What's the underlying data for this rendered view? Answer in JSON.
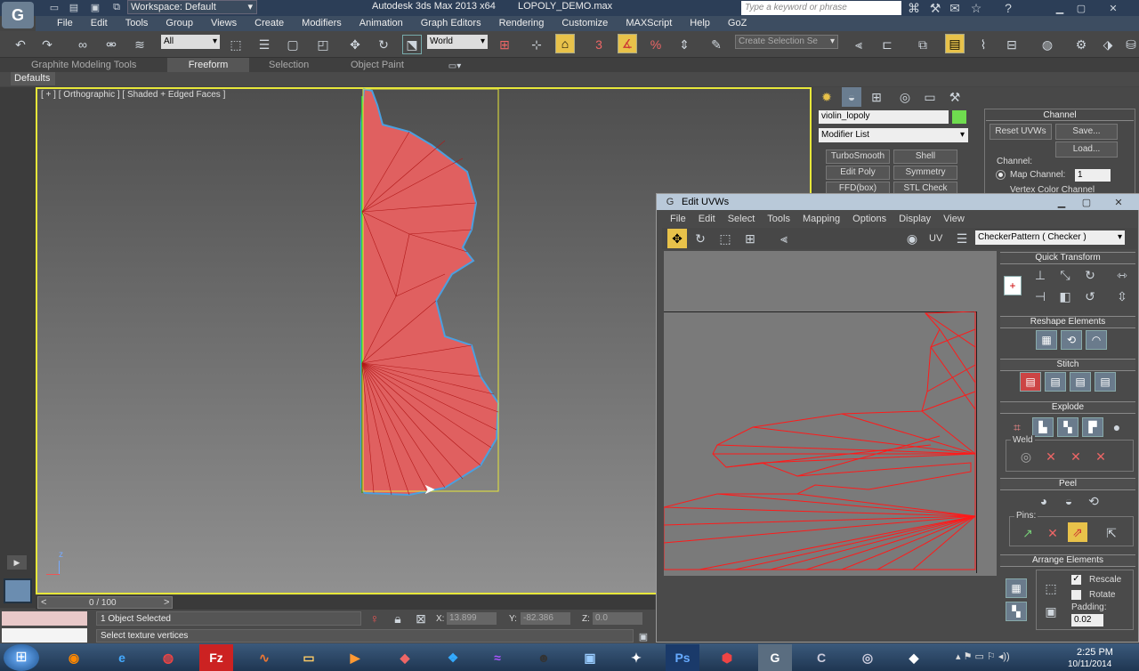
{
  "title_bar": {
    "workspace": "Workspace: Default",
    "app_title": "Autodesk 3ds Max  2013 x64",
    "file_name": "LOPOLY_DEMO.max",
    "search_placeholder": "Type a keyword or phrase"
  },
  "menu": [
    "File",
    "Edit",
    "Tools",
    "Group",
    "Views",
    "Create",
    "Modifiers",
    "Animation",
    "Graph Editors",
    "Rendering",
    "Customize",
    "MAXScript",
    "Help",
    "GoZ"
  ],
  "toolbar": {
    "selection_filter": "All",
    "ref_coord": "World",
    "sel_set_placeholder": "Create Selection Se"
  },
  "ribbon": {
    "tabs": [
      "Graphite Modeling Tools",
      "Freeform",
      "Selection",
      "Object Paint"
    ],
    "active": "Freeform",
    "defaults": "Defaults"
  },
  "viewport": {
    "label": "[ + ] [ Orthographic ] [ Shaded + Edged Faces ]",
    "axis_z": "z",
    "axis_x": "x"
  },
  "command_panel": {
    "object_name": "violin_lopoly",
    "object_color": "#6fdc4f",
    "modifier_list": "Modifier List",
    "modifier_buttons": [
      "TurboSmooth",
      "Shell",
      "Edit Poly",
      "Symmetry",
      "FFD(box)",
      "STL Check"
    ]
  },
  "channel_panel": {
    "title": "Channel",
    "reset": "Reset UVWs",
    "save": "Save...",
    "load": "Load...",
    "channel_label": "Channel:",
    "map_channel": "Map Channel:",
    "map_value": "1",
    "vertex_color": "Vertex Color Channel"
  },
  "uvw": {
    "title": "Edit UVWs",
    "menu": [
      "File",
      "Edit",
      "Select",
      "Tools",
      "Mapping",
      "Options",
      "Display",
      "View"
    ],
    "uv_label": "UV",
    "map_dropdown": "CheckerPattern  ( Checker )",
    "sections": {
      "quick": "Quick Transform",
      "reshape": "Reshape Elements",
      "stitch": "Stitch",
      "explode": "Explode",
      "weld": "Weld",
      "peel": "Peel",
      "pins": "Pins:",
      "arrange": "Arrange Elements"
    },
    "rescale": "Rescale",
    "rotate": "Rotate",
    "padding_label": "Padding:",
    "padding_value": "0.02"
  },
  "timeline": {
    "frame": "0 / 100"
  },
  "status": {
    "selected": "1 Object Selected",
    "prompt": "Select texture vertices",
    "x_label": "X:",
    "x_value": "13.899",
    "y_label": "Y:",
    "y_value": "-82.386",
    "z_label": "Z:",
    "z_value": "0.0"
  },
  "taskbar": {
    "time": "2:25 PM",
    "date": "10/11/2014"
  }
}
